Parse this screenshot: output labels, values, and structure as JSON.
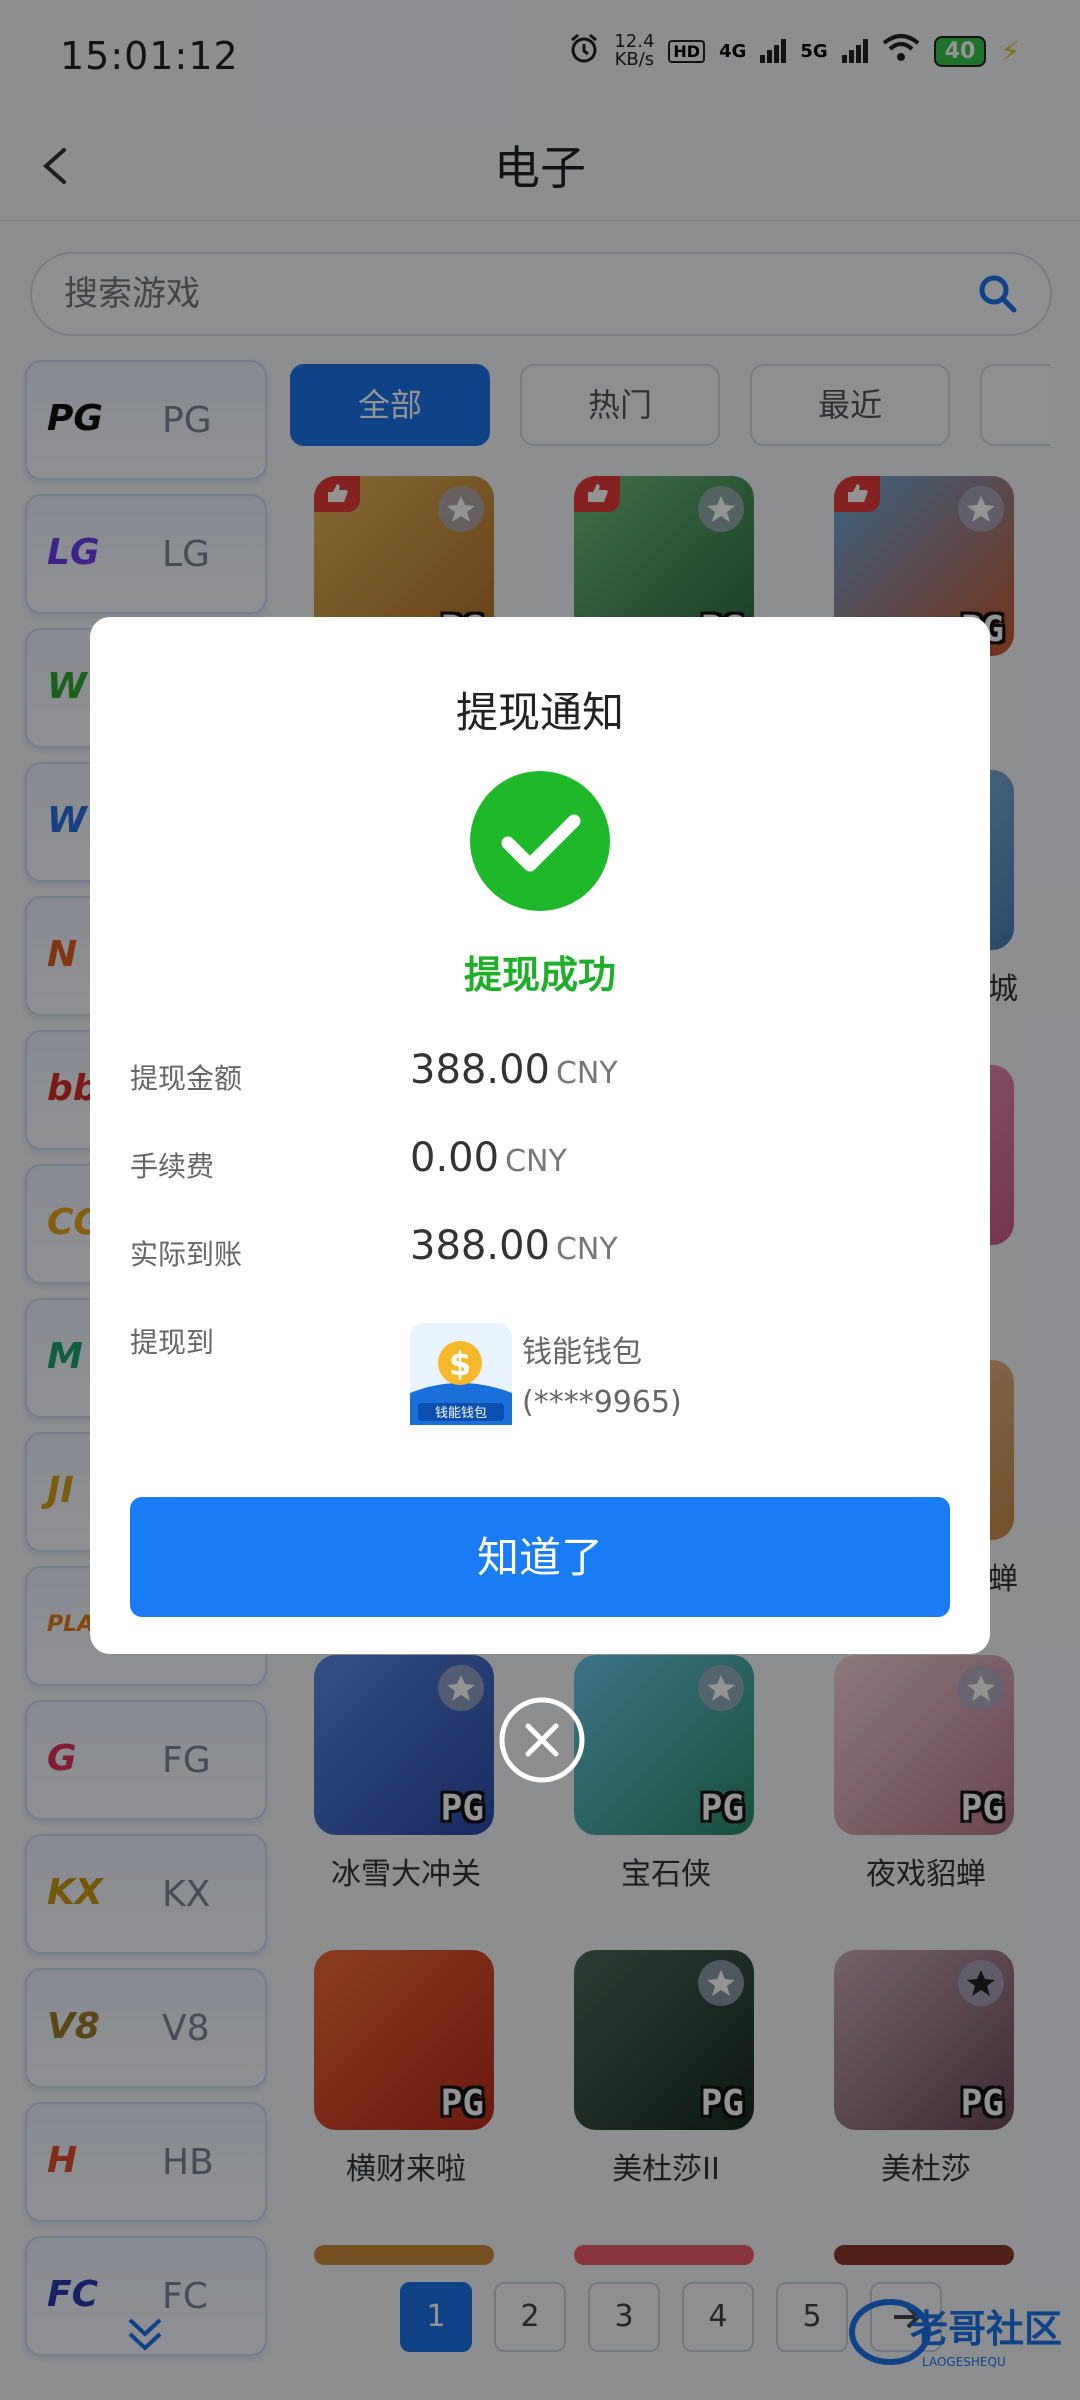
{
  "status_bar": {
    "time": "15:01:12",
    "net_speed_value": "12.4",
    "net_speed_unit": "KB/s",
    "hd": "HD",
    "sig1": "4G",
    "sig2": "5G",
    "battery": "40"
  },
  "nav": {
    "title": "电子"
  },
  "search": {
    "placeholder": "搜索游戏"
  },
  "providers": [
    {
      "logo": "PG",
      "label": "PG",
      "color": "#111111"
    },
    {
      "logo": "LG",
      "label": "LG",
      "color": "#6b3df0"
    },
    {
      "logo": "W",
      "label": "",
      "color": "#2fa52f"
    },
    {
      "logo": "W",
      "label": "",
      "color": "#2b6fe0"
    },
    {
      "logo": "N",
      "label": "",
      "color": "#e05a22"
    },
    {
      "logo": "bb",
      "label": "",
      "color": "#d82a2a"
    },
    {
      "logo": "CG",
      "label": "",
      "color": "#e6a21a"
    },
    {
      "logo": "M",
      "label": "",
      "color": "#1aa36b"
    },
    {
      "logo": "JI",
      "label": "",
      "color": "#d6a01a"
    },
    {
      "logo": "PLAY",
      "label": "",
      "color": "#e07a1a"
    },
    {
      "logo": "G",
      "label": "FG",
      "color": "#e0305a"
    },
    {
      "logo": "KX",
      "label": "KX",
      "color": "#c79a10"
    },
    {
      "logo": "V8",
      "label": "V8",
      "color": "#9a7a2a"
    },
    {
      "logo": "H",
      "label": "HB",
      "color": "#e04a2a"
    },
    {
      "logo": "FC",
      "label": "FC",
      "color": "#2a3ab0"
    }
  ],
  "tabs": [
    "全部",
    "热门",
    "最近",
    ""
  ],
  "games": [
    {
      "name": "",
      "bg": "#c9913a",
      "liked": true
    },
    {
      "name": "",
      "bg": "#3d8a5a",
      "liked": true
    },
    {
      "name": "",
      "bg": "#3c7ab8",
      "liked": true
    },
    {
      "name": "冰雪大冲关",
      "bg": "#3a6fc8",
      "liked": false
    },
    {
      "name": "宝石侠",
      "bg": "#4bb0d8",
      "liked": false
    },
    {
      "name": "夜戏貂蝉",
      "bg": "#d6a8b4",
      "liked": false
    },
    {
      "name": "横财来啦",
      "bg": "#d94a2a",
      "liked": false
    },
    {
      "name": "美杜莎II",
      "bg": "#2f4a3a",
      "liked": false
    },
    {
      "name": "美杜莎",
      "bg": "#8a6a7a",
      "liked": false
    }
  ],
  "side_labels": [
    "城",
    "蝉"
  ],
  "pagination": [
    "1",
    "2",
    "3",
    "4",
    "5"
  ],
  "watermark": {
    "text": "老哥社区",
    "sub": "LAOGESHEQU"
  },
  "modal": {
    "title": "提现通知",
    "status": "提现成功",
    "rows": [
      {
        "label": "提现金额",
        "value": "388.00",
        "currency": "CNY"
      },
      {
        "label": "手续费",
        "value": "0.00",
        "currency": "CNY"
      },
      {
        "label": "实际到账",
        "value": "388.00",
        "currency": "CNY"
      }
    ],
    "to_label": "提现到",
    "wallet_name": "钱能钱包",
    "wallet_account": "(****9965)",
    "wallet_logo_text": "钱能钱包",
    "confirm_label": "知道了",
    "success_color": "#20b82b",
    "accent": "#1a7cf5"
  }
}
